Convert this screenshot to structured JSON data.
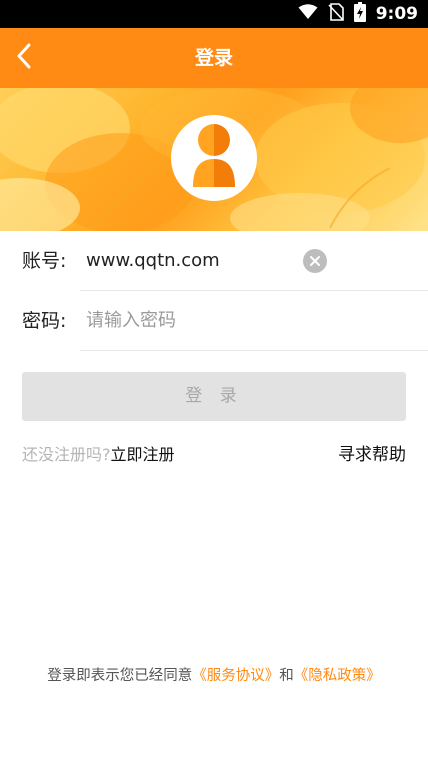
{
  "status_bar": {
    "time": "9:09",
    "icons": [
      "wifi-icon",
      "no-sim-icon",
      "battery-charging-icon"
    ]
  },
  "header": {
    "title": "登录",
    "back_icon": "chevron-left-icon"
  },
  "banner": {
    "avatar_icon": "user-avatar-icon"
  },
  "form": {
    "account_label": "账号:",
    "account_value": "www.qqtn.com",
    "clear_icon": "clear-icon",
    "password_label": "密码:",
    "password_placeholder": "请输入密码"
  },
  "login_button": "登 录",
  "links": {
    "not_registered": "还没注册吗?",
    "register_now": "立即注册",
    "seek_help": "寻求帮助"
  },
  "agreement": {
    "prefix": "登录即表示您已经同意",
    "service": "《服务协议》",
    "and": "和",
    "privacy": "《隐私政策》"
  },
  "colors": {
    "accent": "#ff8a14",
    "button_disabled_bg": "#e2e2e2",
    "button_disabled_text": "#a8a8a8"
  }
}
